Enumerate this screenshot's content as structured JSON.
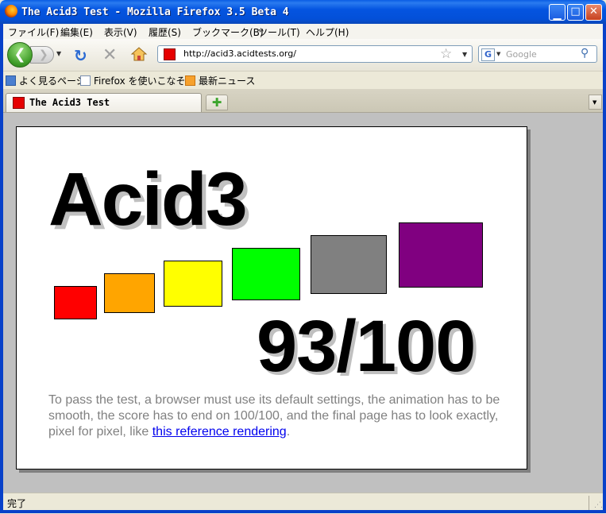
{
  "window": {
    "title": "The Acid3 Test - Mozilla Firefox 3.5 Beta 4"
  },
  "menu": [
    "ファイル(F)",
    "編集(E)",
    "表示(V)",
    "履歴(S)",
    "ブックマーク(B)",
    "ツール(T)",
    "ヘルプ(H)"
  ],
  "nav": {
    "url": "http://acid3.acidtests.org/",
    "search_placeholder": "Google",
    "search_engine_glyph": "G"
  },
  "bookmarks": [
    "よく見るページ",
    "Firefox を使いこなそう",
    "最新ニュース"
  ],
  "tabs": [
    {
      "label": "The Acid3 Test"
    }
  ],
  "page": {
    "heading": "Acid3",
    "score": "93/100",
    "description": "To pass the test, a browser must use its default settings, the animation has to be smooth, the score has to end on 100/100, and the final page has to look exactly, pixel for pixel, like ",
    "link_text": "this reference rendering",
    "description_end": ".",
    "square_colors": [
      "#ff0000",
      "#ffa500",
      "#ffff00",
      "#00ff00",
      "#808080",
      "#800080"
    ]
  },
  "status": {
    "text": "完了"
  }
}
